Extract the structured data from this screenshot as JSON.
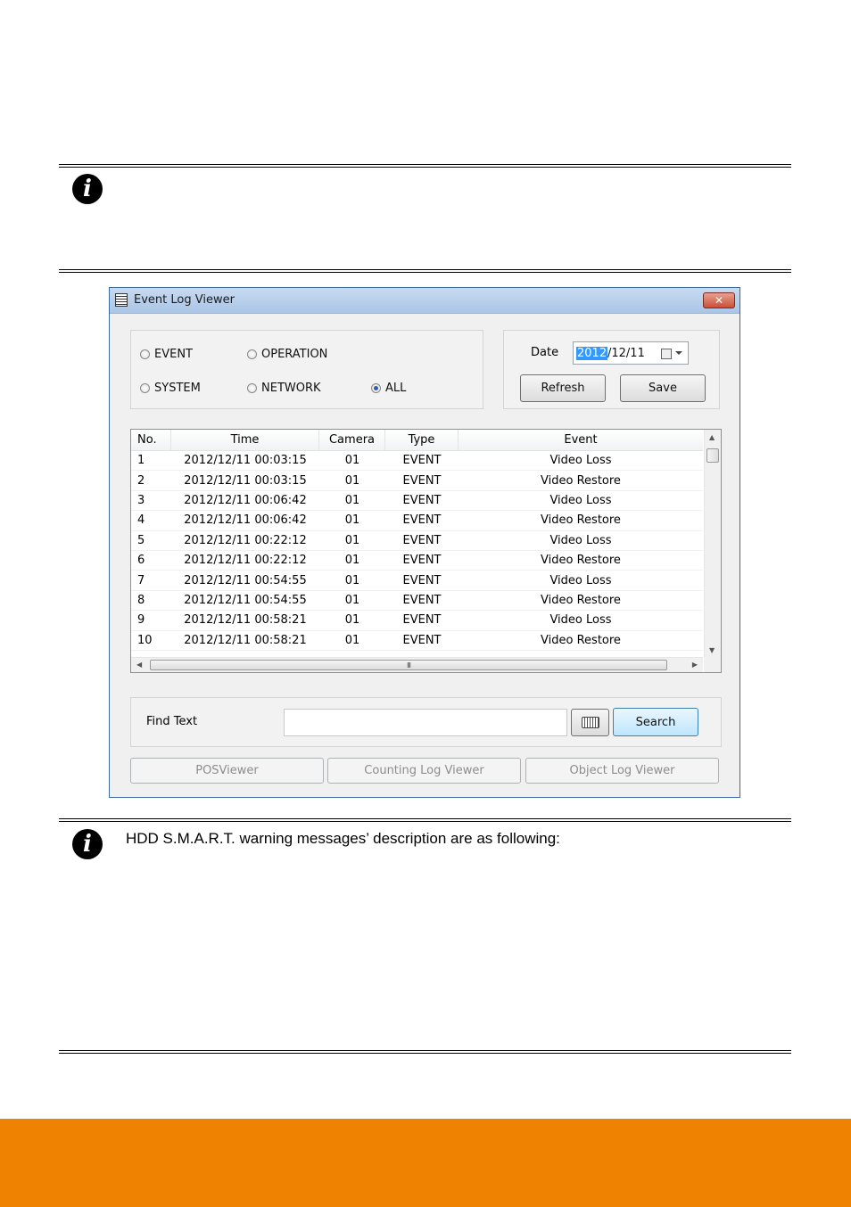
{
  "note2": {
    "text": "HDD S.M.A.R.T. warning messages’ description are as following:"
  },
  "dialog": {
    "title": "Event Log Viewer",
    "close_label": "✕",
    "filters": [
      {
        "label": "EVENT",
        "selected": false
      },
      {
        "label": "OPERATION",
        "selected": false
      },
      {
        "label": "SYSTEM",
        "selected": false
      },
      {
        "label": "NETWORK",
        "selected": false
      },
      {
        "label": "ALL",
        "selected": true
      }
    ],
    "date": {
      "label": "Date",
      "year_selected": "2012",
      "rest": "/12/11"
    },
    "refresh_label": "Refresh",
    "save_label": "Save",
    "table": {
      "columns": [
        "No.",
        "Time",
        "Camera",
        "Type",
        "Event"
      ],
      "rows": [
        [
          "1",
          "2012/12/11 00:03:15",
          "01",
          "EVENT",
          "Video Loss"
        ],
        [
          "2",
          "2012/12/11 00:03:15",
          "01",
          "EVENT",
          "Video Restore"
        ],
        [
          "3",
          "2012/12/11 00:06:42",
          "01",
          "EVENT",
          "Video Loss"
        ],
        [
          "4",
          "2012/12/11 00:06:42",
          "01",
          "EVENT",
          "Video Restore"
        ],
        [
          "5",
          "2012/12/11 00:22:12",
          "01",
          "EVENT",
          "Video Loss"
        ],
        [
          "6",
          "2012/12/11 00:22:12",
          "01",
          "EVENT",
          "Video Restore"
        ],
        [
          "7",
          "2012/12/11 00:54:55",
          "01",
          "EVENT",
          "Video Loss"
        ],
        [
          "8",
          "2012/12/11 00:54:55",
          "01",
          "EVENT",
          "Video Restore"
        ],
        [
          "9",
          "2012/12/11 00:58:21",
          "01",
          "EVENT",
          "Video Loss"
        ],
        [
          "10",
          "2012/12/11 00:58:21",
          "01",
          "EVENT",
          "Video Restore"
        ]
      ],
      "hscroll_grip": "III"
    },
    "find": {
      "label": "Find Text",
      "value": "",
      "search_label": "Search"
    },
    "bottom_buttons": [
      "POSViewer",
      "Counting Log Viewer",
      "Object Log Viewer"
    ]
  },
  "colors": {
    "footer": "#ef8200",
    "title_bar": "#b9d1ea",
    "selection": "#3399ff"
  },
  "icons": [
    "info-icon",
    "app-icon",
    "calendar-icon",
    "keyboard-icon"
  ]
}
